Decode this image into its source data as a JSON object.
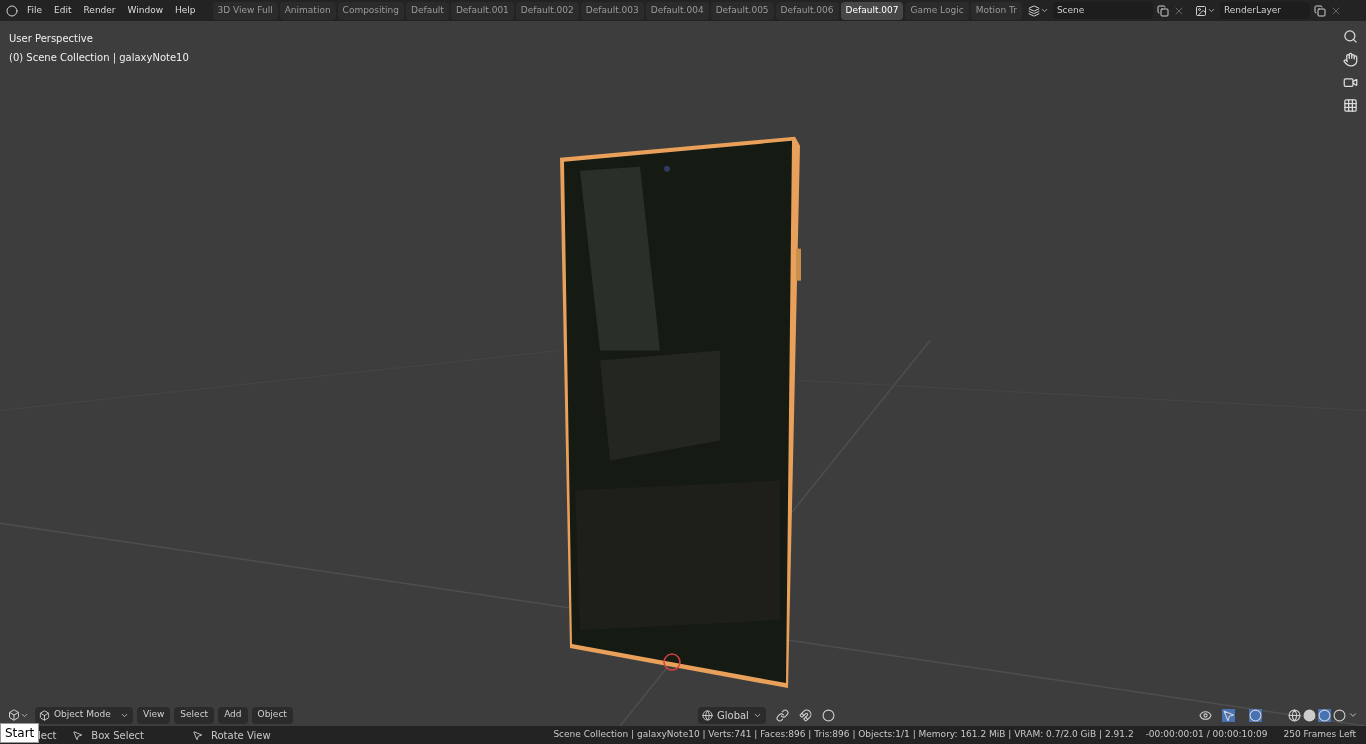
{
  "menu": [
    "File",
    "Edit",
    "Render",
    "Window",
    "Help"
  ],
  "workspaces": [
    {
      "label": "3D View Full",
      "selected": false
    },
    {
      "label": "Animation",
      "selected": false
    },
    {
      "label": "Compositing",
      "selected": false
    },
    {
      "label": "Default",
      "selected": false
    },
    {
      "label": "Default.001",
      "selected": false
    },
    {
      "label": "Default.002",
      "selected": false
    },
    {
      "label": "Default.003",
      "selected": false
    },
    {
      "label": "Default.004",
      "selected": false
    },
    {
      "label": "Default.005",
      "selected": false
    },
    {
      "label": "Default.006",
      "selected": false
    },
    {
      "label": "Default.007",
      "selected": true
    },
    {
      "label": "Game Logic",
      "selected": false
    },
    {
      "label": "Motion Tr",
      "selected": false
    }
  ],
  "scene": {
    "value": "Scene"
  },
  "view_layer": {
    "value": "RenderLayer"
  },
  "viewport": {
    "title": "User Perspective",
    "subtitle": "(0) Scene Collection | galaxyNote10"
  },
  "header": {
    "mode": "Object Mode",
    "menus": [
      "View",
      "Select",
      "Add",
      "Object"
    ],
    "orientation": "Global"
  },
  "tooltip": "Start",
  "status_bar": {
    "hints": [
      "lect",
      "Box Select",
      "Rotate View"
    ],
    "stats": "Scene Collection | galaxyNote10 | Verts:741 | Faces:896 | Tris:896 | Objects:1/1 | Memory: 161.2 MiB | VRAM: 0.7/2.0 GiB | 2.91.2",
    "time": "-00:00:00:01 / 00:00:10:09",
    "frames": "250 Frames Left"
  }
}
